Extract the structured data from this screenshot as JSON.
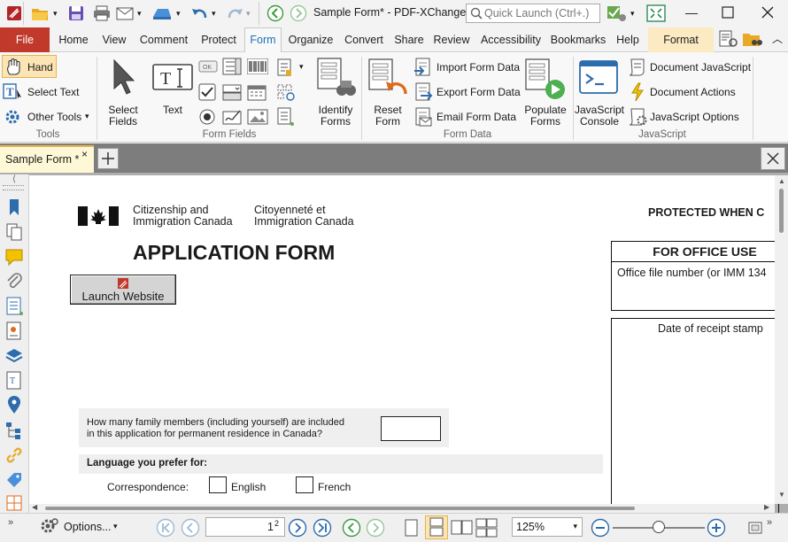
{
  "window": {
    "title": "Sample Form* - PDF-XChange ..",
    "quick_launch_placeholder": "Quick Launch (Ctrl+.)"
  },
  "ribbon_tabs": [
    {
      "label": "File"
    },
    {
      "label": "Home"
    },
    {
      "label": "View"
    },
    {
      "label": "Comment"
    },
    {
      "label": "Protect"
    },
    {
      "label": "Form"
    },
    {
      "label": "Organize"
    },
    {
      "label": "Convert"
    },
    {
      "label": "Share"
    },
    {
      "label": "Review"
    },
    {
      "label": "Accessibility"
    },
    {
      "label": "Bookmarks"
    },
    {
      "label": "Help"
    },
    {
      "label": "Format"
    }
  ],
  "ribbon": {
    "tools": {
      "group_label": "Tools",
      "hand": "Hand",
      "select_text": "Select Text",
      "other_tools": "Other Tools"
    },
    "form_fields": {
      "group_label": "Form Fields",
      "select_fields_1": "Select",
      "select_fields_2": "Fields",
      "text": "Text",
      "identify_forms_1": "Identify",
      "identify_forms_2": "Forms"
    },
    "form_data": {
      "group_label": "Form Data",
      "reset_form_1": "Reset",
      "reset_form_2": "Form",
      "import": "Import Form Data",
      "export": "Export Form Data",
      "email": "Email Form Data",
      "populate_1": "Populate",
      "populate_2": "Forms"
    },
    "javascript": {
      "group_label": "JavaScript",
      "console_1": "JavaScript",
      "console_2": "Console",
      "document_js": "Document JavaScript",
      "document_actions": "Document Actions",
      "js_options": "JavaScript Options"
    }
  },
  "document_tab": {
    "label": "Sample Form *"
  },
  "page": {
    "dept_en_1": "Citizenship and",
    "dept_en_2": "Immigration Canada",
    "dept_fr_1": "Citoyenneté et",
    "dept_fr_2": "Immigration Canada",
    "protected": "PROTECTED WHEN C",
    "title": "APPLICATION FORM",
    "launch_button": "Launch Website",
    "office_use": "FOR OFFICE USE",
    "office_file": "Office file number (or IMM 134",
    "receipt": "Date of receipt stamp",
    "family_q1": "How many family members (including yourself) are included",
    "family_q2": "in this application for permanent residence in Canada?",
    "language_label": "Language you prefer for:",
    "correspondence": "Correspondence:",
    "english": "English",
    "french": "French"
  },
  "statusbar": {
    "options": "Options...",
    "page_current": "1",
    "page_total": "2",
    "zoom": "125%"
  },
  "zoom_slider": {
    "position": 0.5
  },
  "colors": {
    "file_tab": "#c0392b",
    "format_tab": "#fbeac2",
    "accent_blue": "#1f6fb5",
    "doc_tab_bg": "#fff8d6"
  }
}
